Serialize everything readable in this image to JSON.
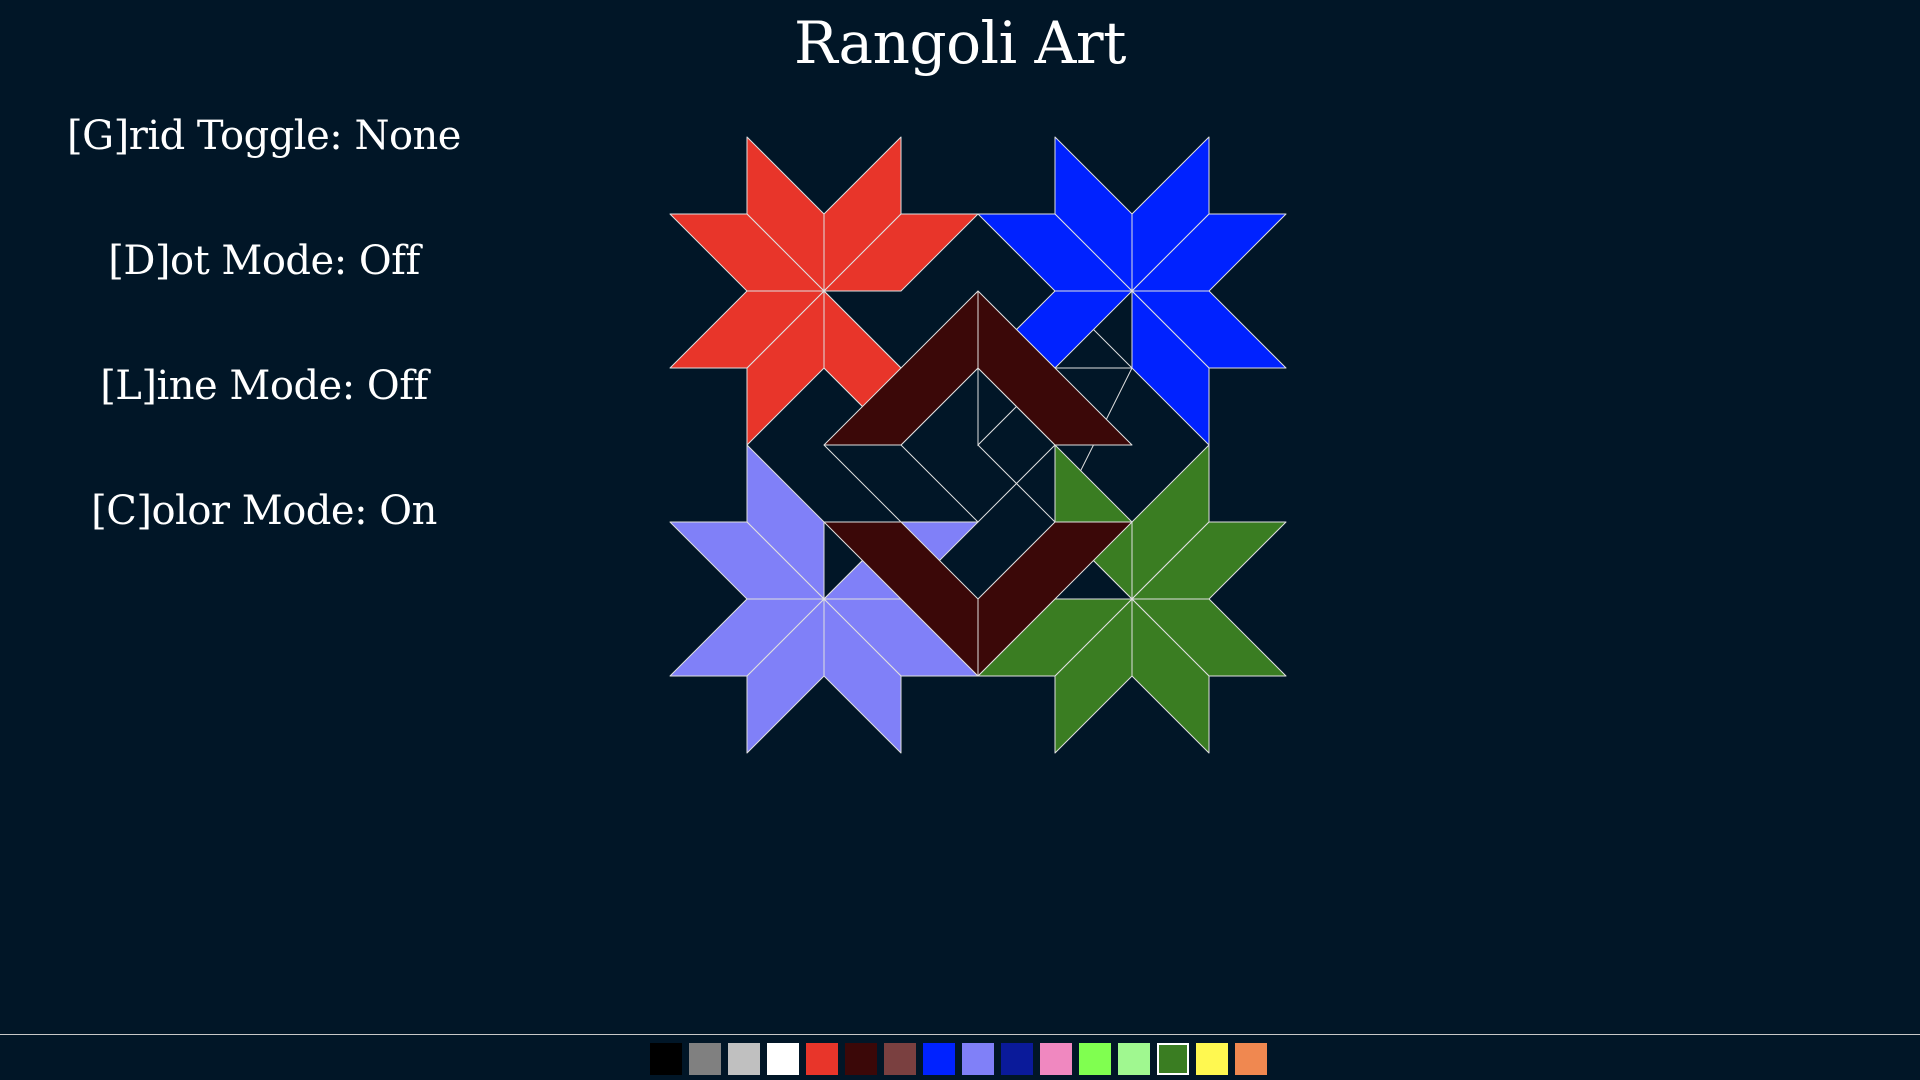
{
  "app": {
    "title": "Rangoli Art"
  },
  "modes": {
    "grid": "[G]rid Toggle: None",
    "dot": "[D]ot Mode: Off",
    "line": "[L]ine Mode: Off",
    "color": "[C]olor Mode: On"
  },
  "colors": {
    "background": "#011627",
    "outline": "#e0e0e0",
    "red_flower": "#e8352a",
    "blue_flower": "#0022ff",
    "lavender_flower": "#8080f8",
    "green_flower": "#3a7d22",
    "dark_petal": "#3b0808"
  },
  "palette": {
    "swatches": [
      {
        "color": "#000000",
        "selected": false
      },
      {
        "color": "#808080",
        "selected": false
      },
      {
        "color": "#c0c0c0",
        "selected": false
      },
      {
        "color": "#ffffff",
        "selected": false
      },
      {
        "color": "#e8352a",
        "selected": false
      },
      {
        "color": "#3b0808",
        "selected": false
      },
      {
        "color": "#7a4040",
        "selected": false
      },
      {
        "color": "#0022ff",
        "selected": false
      },
      {
        "color": "#8080f8",
        "selected": false
      },
      {
        "color": "#0a1a9a",
        "selected": false
      },
      {
        "color": "#f088c0",
        "selected": false
      },
      {
        "color": "#80ff50",
        "selected": false
      },
      {
        "color": "#a0f890",
        "selected": false
      },
      {
        "color": "#3a7d22",
        "selected": true
      },
      {
        "color": "#fff850",
        "selected": false
      },
      {
        "color": "#f08850",
        "selected": false
      }
    ]
  }
}
